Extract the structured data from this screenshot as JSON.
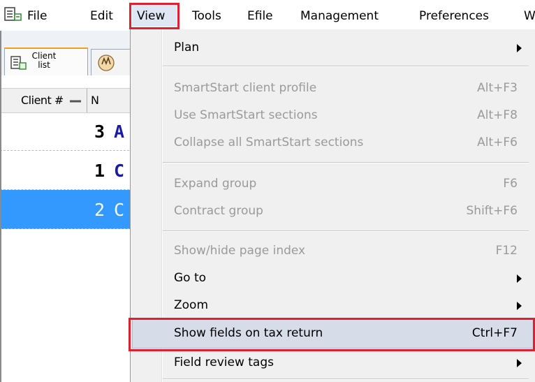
{
  "menubar": {
    "items": [
      "File",
      "Edit",
      "View",
      "Tools",
      "Efile",
      "Management",
      "Preferences",
      "W"
    ],
    "active": "View"
  },
  "panel": {
    "tab_client_label_1": "Client",
    "tab_client_label_2": "list",
    "column_header": "Client #",
    "column_next": "N",
    "rows": [
      {
        "num": "3",
        "name_start": "A",
        "selected": false
      },
      {
        "num": "1",
        "name_start": "C",
        "selected": false
      },
      {
        "num": "2",
        "name_start": "C",
        "selected": true
      }
    ]
  },
  "menu": {
    "items": [
      {
        "label": "Plan",
        "shortcut": "",
        "submenu": true,
        "enabled": true
      },
      {
        "label": "SmartStart client profile",
        "shortcut": "Alt+F3",
        "submenu": false,
        "enabled": false
      },
      {
        "label": "Use SmartStart sections",
        "shortcut": "Alt+F8",
        "submenu": false,
        "enabled": false
      },
      {
        "label": "Collapse all SmartStart sections",
        "shortcut": "Alt+F6",
        "submenu": false,
        "enabled": false
      },
      {
        "label": "Expand group",
        "shortcut": "F6",
        "submenu": false,
        "enabled": false
      },
      {
        "label": "Contract group",
        "shortcut": "Shift+F6",
        "submenu": false,
        "enabled": false
      },
      {
        "label": "Show/hide page index",
        "shortcut": "F12",
        "submenu": false,
        "enabled": false
      },
      {
        "label": "Go to",
        "shortcut": "",
        "submenu": true,
        "enabled": true
      },
      {
        "label": "Zoom",
        "shortcut": "",
        "submenu": true,
        "enabled": true
      },
      {
        "label": "Show fields on tax return",
        "shortcut": "Ctrl+F7",
        "submenu": false,
        "enabled": true,
        "highlighted": true
      },
      {
        "label": "Field review tags",
        "shortcut": "",
        "submenu": true,
        "enabled": true
      }
    ]
  },
  "colors": {
    "highlight_border": "#e02030",
    "selection_blue": "#3399ff",
    "disabled_text": "#9a9a9a"
  },
  "icons": [
    "app-icon",
    "client-list-icon",
    "hand-icon",
    "sort-icon",
    "submenu-arrow-icon"
  ]
}
